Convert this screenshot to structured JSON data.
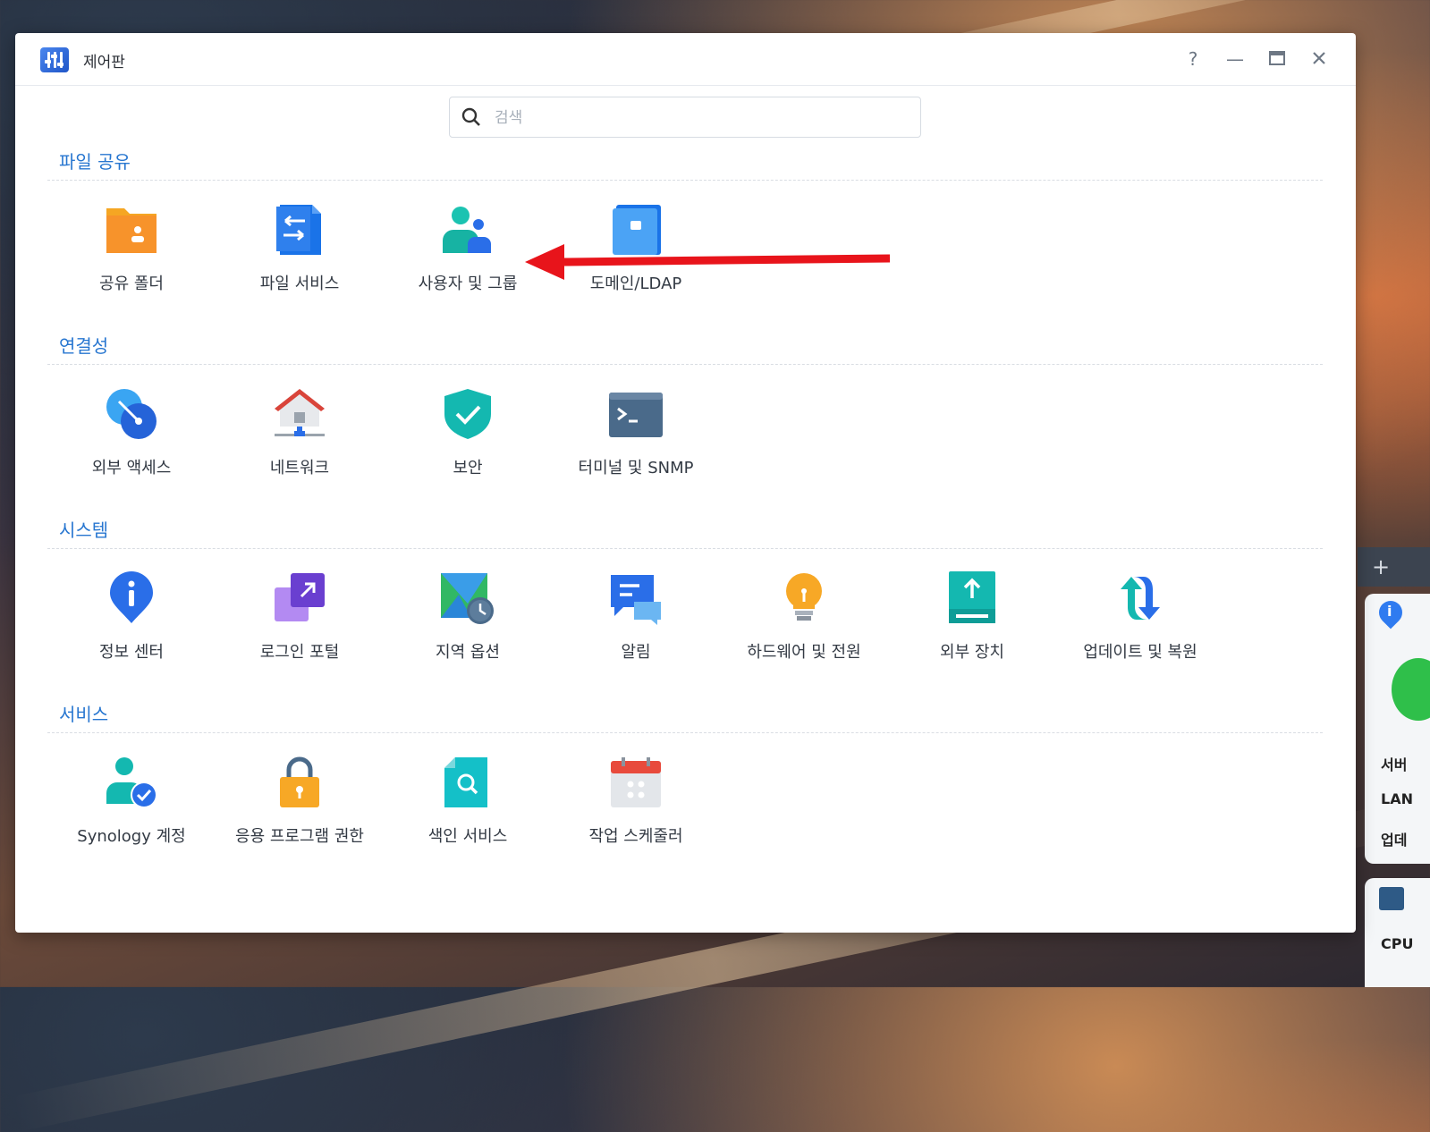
{
  "window": {
    "title": "제어판",
    "help_label": "?",
    "minimize_label": "—",
    "maximize_label": "▭",
    "close_label": "✕"
  },
  "search": {
    "placeholder": "검색",
    "value": ""
  },
  "sections": [
    {
      "title": "파일 공유",
      "items": [
        {
          "label": "공유 폴더",
          "icon": "shared-folder-icon"
        },
        {
          "label": "파일 서비스",
          "icon": "file-services-icon"
        },
        {
          "label": "사용자 및 그룹",
          "icon": "user-group-icon"
        },
        {
          "label": "도메인/LDAP",
          "icon": "domain-ldap-icon"
        }
      ]
    },
    {
      "title": "연결성",
      "items": [
        {
          "label": "외부 액세스",
          "icon": "external-access-icon"
        },
        {
          "label": "네트워크",
          "icon": "network-icon"
        },
        {
          "label": "보안",
          "icon": "security-shield-icon"
        },
        {
          "label": "터미널 및 SNMP",
          "icon": "terminal-icon"
        }
      ]
    },
    {
      "title": "시스템",
      "items": [
        {
          "label": "정보 센터",
          "icon": "info-center-icon"
        },
        {
          "label": "로그인 포털",
          "icon": "login-portal-icon"
        },
        {
          "label": "지역 옵션",
          "icon": "regional-options-icon"
        },
        {
          "label": "알림",
          "icon": "notification-icon"
        },
        {
          "label": "하드웨어 및 전원",
          "icon": "hardware-power-icon"
        },
        {
          "label": "외부 장치",
          "icon": "external-devices-icon"
        },
        {
          "label": "업데이트 및 복원",
          "icon": "update-restore-icon"
        }
      ]
    },
    {
      "title": "서비스",
      "items": [
        {
          "label": "Synology 계정",
          "icon": "synology-account-icon"
        },
        {
          "label": "응용 프로그램 권한",
          "icon": "app-privileges-icon"
        },
        {
          "label": "색인 서비스",
          "icon": "indexing-service-icon"
        },
        {
          "label": "작업 스케줄러",
          "icon": "task-scheduler-icon"
        }
      ]
    }
  ],
  "side_widgets": {
    "add_label": "+",
    "text_1": "서버",
    "text_2": "LAN",
    "text_3": "업데",
    "text_4": "CPU"
  },
  "annotation": {
    "arrow_color": "#e8141b",
    "points_to": "사용자 및 그룹"
  }
}
